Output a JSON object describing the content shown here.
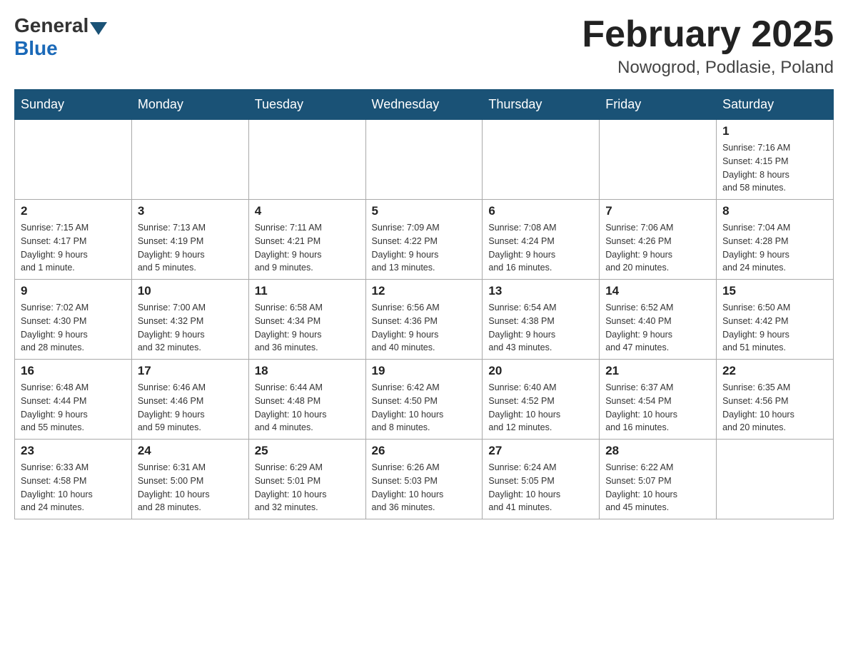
{
  "header": {
    "logo_general": "General",
    "logo_blue": "Blue",
    "month_title": "February 2025",
    "location": "Nowogrod, Podlasie, Poland"
  },
  "weekdays": [
    "Sunday",
    "Monday",
    "Tuesday",
    "Wednesday",
    "Thursday",
    "Friday",
    "Saturday"
  ],
  "weeks": [
    [
      {
        "day": "",
        "info": ""
      },
      {
        "day": "",
        "info": ""
      },
      {
        "day": "",
        "info": ""
      },
      {
        "day": "",
        "info": ""
      },
      {
        "day": "",
        "info": ""
      },
      {
        "day": "",
        "info": ""
      },
      {
        "day": "1",
        "info": "Sunrise: 7:16 AM\nSunset: 4:15 PM\nDaylight: 8 hours\nand 58 minutes."
      }
    ],
    [
      {
        "day": "2",
        "info": "Sunrise: 7:15 AM\nSunset: 4:17 PM\nDaylight: 9 hours\nand 1 minute."
      },
      {
        "day": "3",
        "info": "Sunrise: 7:13 AM\nSunset: 4:19 PM\nDaylight: 9 hours\nand 5 minutes."
      },
      {
        "day": "4",
        "info": "Sunrise: 7:11 AM\nSunset: 4:21 PM\nDaylight: 9 hours\nand 9 minutes."
      },
      {
        "day": "5",
        "info": "Sunrise: 7:09 AM\nSunset: 4:22 PM\nDaylight: 9 hours\nand 13 minutes."
      },
      {
        "day": "6",
        "info": "Sunrise: 7:08 AM\nSunset: 4:24 PM\nDaylight: 9 hours\nand 16 minutes."
      },
      {
        "day": "7",
        "info": "Sunrise: 7:06 AM\nSunset: 4:26 PM\nDaylight: 9 hours\nand 20 minutes."
      },
      {
        "day": "8",
        "info": "Sunrise: 7:04 AM\nSunset: 4:28 PM\nDaylight: 9 hours\nand 24 minutes."
      }
    ],
    [
      {
        "day": "9",
        "info": "Sunrise: 7:02 AM\nSunset: 4:30 PM\nDaylight: 9 hours\nand 28 minutes."
      },
      {
        "day": "10",
        "info": "Sunrise: 7:00 AM\nSunset: 4:32 PM\nDaylight: 9 hours\nand 32 minutes."
      },
      {
        "day": "11",
        "info": "Sunrise: 6:58 AM\nSunset: 4:34 PM\nDaylight: 9 hours\nand 36 minutes."
      },
      {
        "day": "12",
        "info": "Sunrise: 6:56 AM\nSunset: 4:36 PM\nDaylight: 9 hours\nand 40 minutes."
      },
      {
        "day": "13",
        "info": "Sunrise: 6:54 AM\nSunset: 4:38 PM\nDaylight: 9 hours\nand 43 minutes."
      },
      {
        "day": "14",
        "info": "Sunrise: 6:52 AM\nSunset: 4:40 PM\nDaylight: 9 hours\nand 47 minutes."
      },
      {
        "day": "15",
        "info": "Sunrise: 6:50 AM\nSunset: 4:42 PM\nDaylight: 9 hours\nand 51 minutes."
      }
    ],
    [
      {
        "day": "16",
        "info": "Sunrise: 6:48 AM\nSunset: 4:44 PM\nDaylight: 9 hours\nand 55 minutes."
      },
      {
        "day": "17",
        "info": "Sunrise: 6:46 AM\nSunset: 4:46 PM\nDaylight: 9 hours\nand 59 minutes."
      },
      {
        "day": "18",
        "info": "Sunrise: 6:44 AM\nSunset: 4:48 PM\nDaylight: 10 hours\nand 4 minutes."
      },
      {
        "day": "19",
        "info": "Sunrise: 6:42 AM\nSunset: 4:50 PM\nDaylight: 10 hours\nand 8 minutes."
      },
      {
        "day": "20",
        "info": "Sunrise: 6:40 AM\nSunset: 4:52 PM\nDaylight: 10 hours\nand 12 minutes."
      },
      {
        "day": "21",
        "info": "Sunrise: 6:37 AM\nSunset: 4:54 PM\nDaylight: 10 hours\nand 16 minutes."
      },
      {
        "day": "22",
        "info": "Sunrise: 6:35 AM\nSunset: 4:56 PM\nDaylight: 10 hours\nand 20 minutes."
      }
    ],
    [
      {
        "day": "23",
        "info": "Sunrise: 6:33 AM\nSunset: 4:58 PM\nDaylight: 10 hours\nand 24 minutes."
      },
      {
        "day": "24",
        "info": "Sunrise: 6:31 AM\nSunset: 5:00 PM\nDaylight: 10 hours\nand 28 minutes."
      },
      {
        "day": "25",
        "info": "Sunrise: 6:29 AM\nSunset: 5:01 PM\nDaylight: 10 hours\nand 32 minutes."
      },
      {
        "day": "26",
        "info": "Sunrise: 6:26 AM\nSunset: 5:03 PM\nDaylight: 10 hours\nand 36 minutes."
      },
      {
        "day": "27",
        "info": "Sunrise: 6:24 AM\nSunset: 5:05 PM\nDaylight: 10 hours\nand 41 minutes."
      },
      {
        "day": "28",
        "info": "Sunrise: 6:22 AM\nSunset: 5:07 PM\nDaylight: 10 hours\nand 45 minutes."
      },
      {
        "day": "",
        "info": ""
      }
    ]
  ]
}
